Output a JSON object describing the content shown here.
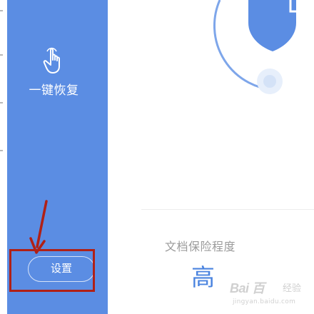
{
  "sidebar": {
    "restore_label": "一键恢复",
    "restore_icon": "touch-hand-icon",
    "settings_label": "设置"
  },
  "main": {
    "protection_label": "文档保险程度",
    "protection_value": "高",
    "shield_icon": "shield-icon"
  },
  "annotation": {
    "highlight_color": "#b02016",
    "arrow_color": "#b02016"
  },
  "watermark": {
    "brand": "Bai  百",
    "suffix": "经验",
    "url": "jingyan.baidu.com"
  },
  "colors": {
    "sidebar_bg": "#5b8de3",
    "accent": "#4a83df"
  }
}
